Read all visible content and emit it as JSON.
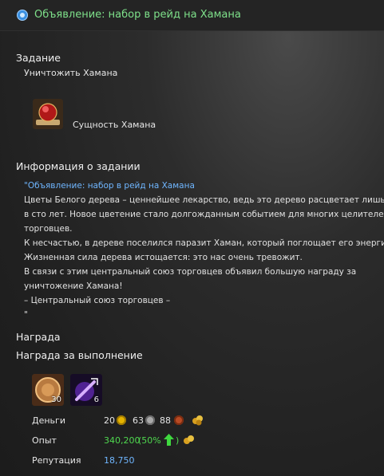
{
  "window": {
    "title": "Объявление: набор в рейд на Хамана"
  },
  "task": {
    "heading": "Задание",
    "objective": "Уничтожить Хамана",
    "item_name": "Сущность Хамана",
    "item_icon": "red-orb-icon"
  },
  "info": {
    "heading": "Информация о задании",
    "lines": [
      "\"Объявление: набор в рейд на Хамана",
      "Цветы Белого дерева – ценнейшее лекарство, ведь это дерево расцветает лишь раз",
      "в сто лет. Новое цветение стало долгожданным событием для многих целителей и",
      "торговцев.",
      "К несчастью, в дереве поселился паразит Хаман, который поглощает его энергию.",
      "Жизненная сила дерева истощается: это нас очень тревожит.",
      "В связи с этим центральный союз торговцев объявил большую награду за",
      "уничтожение Хамана!",
      "– Центральный союз торговцев –",
      "\""
    ]
  },
  "reward": {
    "heading": "Награда",
    "subheading": "Награда за выполнение",
    "items": [
      {
        "icon": "bronze-coin-chest-icon",
        "count": "30"
      },
      {
        "icon": "purple-scroll-icon",
        "count": "6"
      }
    ],
    "money": {
      "label": "Деньги",
      "gold": "20",
      "silver": "63",
      "copper": "88"
    },
    "exp": {
      "label": "Опыт",
      "value": "340,200",
      "bonus_open": "(50%",
      "bonus_close": ")"
    },
    "reputation": {
      "label": "Репутация",
      "value": "18,750"
    }
  },
  "colors": {
    "title": "#7ee08a",
    "link": "#6fb6ff",
    "exp": "#4fd84f",
    "reputation": "#6fb6ff"
  }
}
